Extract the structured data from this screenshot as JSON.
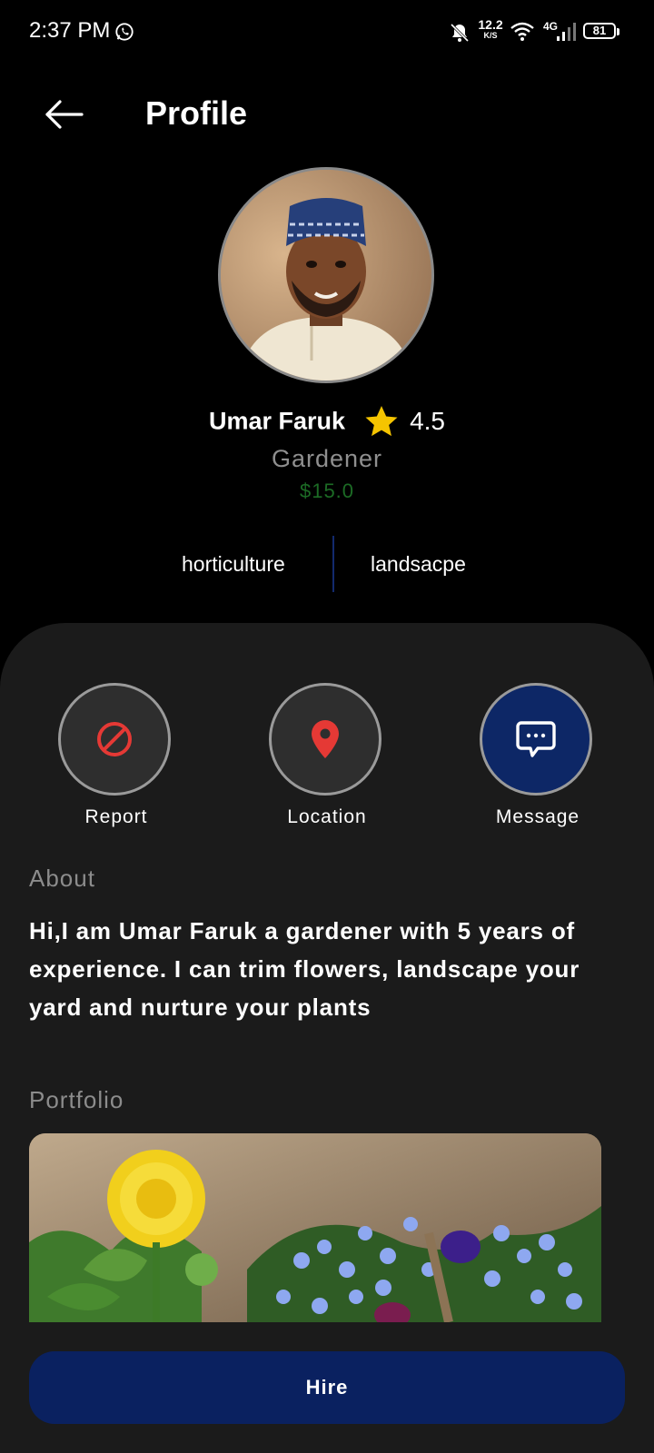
{
  "status_bar": {
    "time": "2:37 PM",
    "speed_value": "12.2",
    "speed_unit": "K/S",
    "network": "4G",
    "battery": "81",
    "icons": [
      "whatsapp-icon",
      "bell-off-icon",
      "wifi-icon",
      "signal-icon",
      "battery-icon"
    ]
  },
  "header": {
    "title": "Profile",
    "back_icon": "arrow-left-icon"
  },
  "profile": {
    "name": "Umar Faruk",
    "rating": "4.5",
    "role": "Gardener",
    "price": "$15.0",
    "skills": [
      "horticulture",
      "landsacpe"
    ]
  },
  "actions": [
    {
      "label": "Report",
      "icon": "block-icon"
    },
    {
      "label": "Location",
      "icon": "location-pin-icon"
    },
    {
      "label": "Message",
      "icon": "chat-bubble-icon"
    }
  ],
  "about": {
    "heading": "About",
    "text": "Hi,I am Umar Faruk a gardener with 5 years of experience. I can trim flowers, landscape your yard and nurture your plants"
  },
  "portfolio": {
    "heading": "Portfolio"
  },
  "hire_button": {
    "label": "Hire"
  },
  "colors": {
    "background": "#000000",
    "sheet": "#1b1b1b",
    "accent_blue": "#0a2160",
    "price_green": "#1c6b25",
    "star": "#f5c400",
    "icon_red": "#e53935"
  }
}
